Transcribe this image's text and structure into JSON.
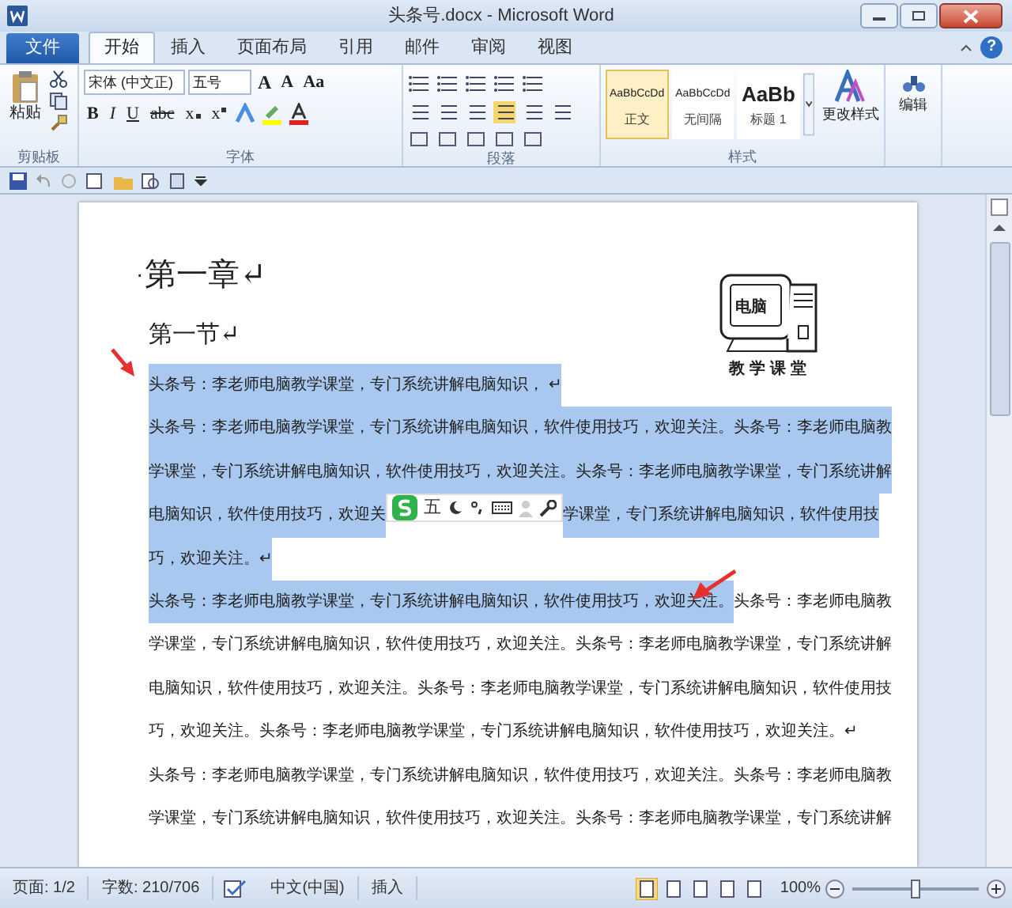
{
  "window": {
    "title": "头条号.docx - Microsoft Word",
    "help": "?"
  },
  "tabs": [
    {
      "label": "文件",
      "kind": "file",
      "selected": false
    },
    {
      "label": "开始",
      "kind": "tab",
      "selected": true
    },
    {
      "label": "插入",
      "kind": "tab",
      "selected": false
    },
    {
      "label": "页面布局",
      "kind": "tab",
      "selected": false
    },
    {
      "label": "引用",
      "kind": "tab",
      "selected": false
    },
    {
      "label": "邮件",
      "kind": "tab",
      "selected": false
    },
    {
      "label": "审阅",
      "kind": "tab",
      "selected": false
    },
    {
      "label": "视图",
      "kind": "tab",
      "selected": false
    }
  ],
  "ribbon": {
    "clipboard": {
      "paste": "粘贴",
      "label": "剪贴板"
    },
    "font": {
      "name": "宋体 (中文正)",
      "size": "五号",
      "label": "字体",
      "row1": [
        {
          "text": "A",
          "kind": "grow"
        },
        {
          "text": "A",
          "kind": "shrink"
        },
        {
          "text": "Aa",
          "kind": "case"
        }
      ],
      "row2": [
        {
          "text": "B",
          "kind": "bold"
        },
        {
          "text": "I",
          "kind": "italic"
        },
        {
          "text": "U",
          "kind": "underline"
        },
        {
          "text": "abc",
          "kind": "strike"
        },
        {
          "text": "x",
          "kind": "sub"
        },
        {
          "text": "x",
          "kind": "sup"
        }
      ]
    },
    "paragraph": {
      "label": "段落"
    },
    "styles": {
      "label": "样式",
      "items": [
        {
          "sample": "AaBbCcDd",
          "name": "正文",
          "kind": "body",
          "selected": true
        },
        {
          "sample": "AaBbCcDd",
          "name": "无间隔",
          "kind": "body",
          "selected": false
        },
        {
          "sample": "AaBb",
          "name": "标题 1",
          "kind": "heading",
          "selected": false
        }
      ],
      "change": "更改样式"
    },
    "editing": {
      "label": "编辑"
    }
  },
  "document": {
    "headings": [
      {
        "bullet": "·",
        "text": "第一章↵",
        "kind": "chapter"
      },
      {
        "text": "第一节↵",
        "kind": "section"
      }
    ],
    "logo": {
      "screen": "电脑",
      "caption": "教学课堂"
    },
    "lines": [
      {
        "segments": [
          {
            "text": "头条号：李老师电脑教学课堂，专门系统讲解电脑知识，  ↵",
            "selected": true
          }
        ]
      },
      {
        "segments": [
          {
            "text": "头条号：李老师电脑教学课堂，专门系统讲解电脑知识，软件使用技巧，欢迎关注。头条号：李老师电脑教",
            "selected": true
          }
        ]
      },
      {
        "segments": [
          {
            "text": "学课堂，专门系统讲解电脑知识，软件使用技巧，欢迎关注。头条号：李老师电脑教学课堂，专门系统讲解",
            "selected": true
          }
        ]
      },
      {
        "segments": [
          {
            "text": "电脑知识，软件使用技巧，欢迎关",
            "selected": true
          },
          {
            "text": "学课堂，专门系统讲解电脑知识，软件使用技",
            "selected": true
          }
        ]
      },
      {
        "segments": [
          {
            "text": "巧，欢迎关注。↵",
            "selected": true
          }
        ]
      },
      {
        "segments": [
          {
            "text": "头条号：李老师电脑教学课堂，专门系统讲解电脑知识，软件使用技巧，欢迎关注。",
            "selected": true
          },
          {
            "text": "头条号：李老师电脑教",
            "selected": false
          }
        ]
      },
      {
        "segments": [
          {
            "text": "学课堂，专门系统讲解电脑知识，软件使用技巧，欢迎关注。头条号：李老师电脑教学课堂，专门系统讲解",
            "selected": false
          }
        ]
      },
      {
        "segments": [
          {
            "text": "电脑知识，软件使用技巧，欢迎关注。头条号：李老师电脑教学课堂，专门系统讲解电脑知识，软件使用技",
            "selected": false
          }
        ]
      },
      {
        "segments": [
          {
            "text": "巧，欢迎关注。头条号：李老师电脑教学课堂，专门系统讲解电脑知识，软件使用技巧，欢迎关注。↵",
            "selected": false
          }
        ]
      },
      {
        "segments": [
          {
            "text": "头条号：李老师电脑教学课堂，专门系统讲解电脑知识，软件使用技巧，欢迎关注。头条号：李老师电脑教",
            "selected": false
          }
        ]
      },
      {
        "segments": [
          {
            "text": "学课堂，专门系统讲解电脑知识，软件使用技巧，欢迎关注。头条号：李老师电脑教学课堂，专门系统讲解",
            "selected": false
          }
        ]
      }
    ],
    "ime_toolbar": {
      "mode": "五"
    }
  },
  "status_bar": {
    "items": [
      "页面: 1/2",
      "字数: 210/706",
      "中文(中国)",
      "插入"
    ],
    "zoom": "100%",
    "zoom_slider": {
      "level": 0.5
    }
  }
}
